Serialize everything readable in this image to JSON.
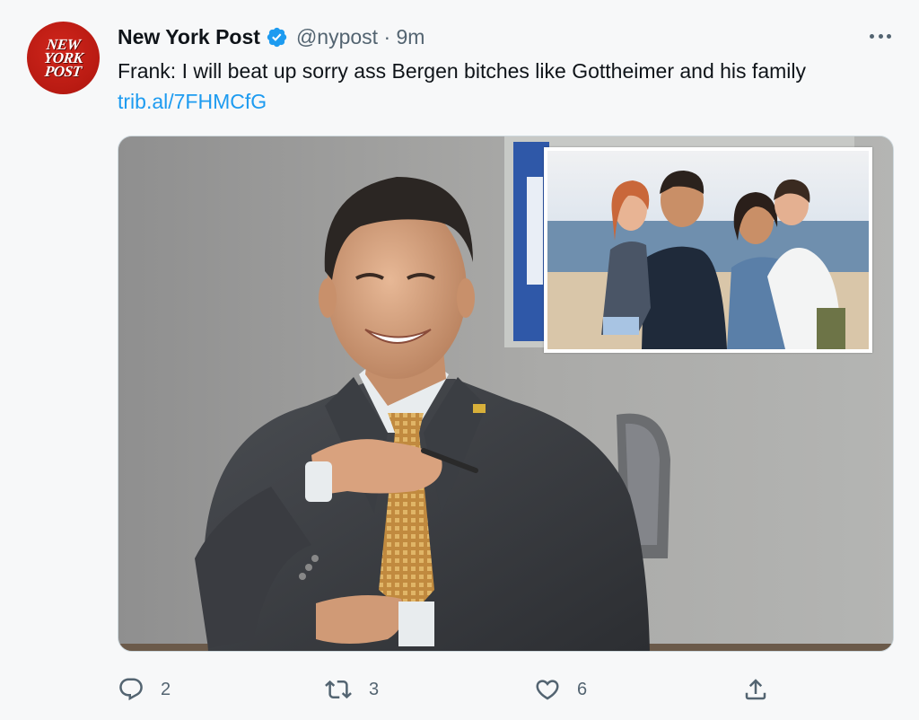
{
  "tweet": {
    "author_name": "New York Post",
    "handle_time": "@nypost · 9m",
    "text": "Frank: I will beat up sorry ass Bergen bitches like Gottheimer and his family",
    "link": "trib.al/7FHMCfG",
    "verified": true
  },
  "avatar": {
    "logo_line1": "NEW",
    "logo_line2": "YORK",
    "logo_line3": "POST",
    "color": "#c8221a"
  },
  "actions": {
    "reply_count": "2",
    "retweet_count": "3",
    "like_count": "6"
  },
  "icons": [
    "verified-badge-icon",
    "more-options-icon",
    "reply-icon",
    "retweet-icon",
    "like-icon",
    "share-icon"
  ],
  "colors": {
    "link": "#1d9bf0",
    "verified": "#1d9bf0",
    "secondary_text": "#536471"
  }
}
